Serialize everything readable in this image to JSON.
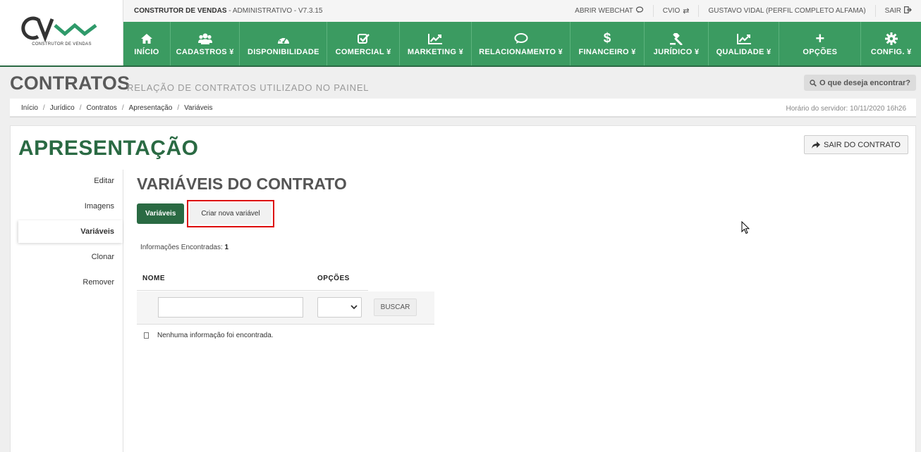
{
  "logo": {
    "subtitle": "CONSTRUTOR DE VENDAS"
  },
  "topbar": {
    "system_name": "CONSTRUTOR DE VENDAS",
    "system_suffix": "- ADMINISTRATIVO - V7.3.15",
    "links": [
      {
        "label": "ABRIR WEBCHAT",
        "icon": "chat-icon"
      },
      {
        "label": "CVIO",
        "icon": "exchange-icon"
      },
      {
        "label": "GUSTAVO VIDAL (PERFIL COMPLETO ALFAMA)",
        "icon": ""
      },
      {
        "label": "SAIR",
        "icon": "logout-icon"
      }
    ]
  },
  "navbar": {
    "items": [
      {
        "label": "INÍCIO",
        "icon": "home-icon"
      },
      {
        "label": "CADASTROS ¥",
        "icon": "users-icon"
      },
      {
        "label": "DISPONIBILIDADE",
        "icon": "dashboard-icon"
      },
      {
        "label": "COMERCIAL ¥",
        "icon": "checkbox-icon"
      },
      {
        "label": "MARKETING ¥",
        "icon": "chart-icon"
      },
      {
        "label": "RELACIONAMENTO ¥",
        "icon": "comments-icon"
      },
      {
        "label": "FINANCEIRO ¥",
        "icon": "dollar-icon"
      },
      {
        "label": "JURÍDICO ¥",
        "icon": "gavel-icon"
      },
      {
        "label": "QUALIDADE ¥",
        "icon": "chart-icon"
      },
      {
        "label": "OPÇÕES",
        "icon": "plus-icon"
      },
      {
        "label": "CONFIG. ¥",
        "icon": "gear-icon"
      }
    ]
  },
  "header": {
    "title": "CONTRATOS",
    "subtitle": "RELAÇÃO DE CONTRATOS UTILIZADO NO PAINEL",
    "search_label": "O que deseja encontrar?"
  },
  "breadcrumb": {
    "items": [
      "Início",
      "Jurídico",
      "Contratos",
      "Apresentação",
      "Variáveis"
    ],
    "server_time": "Horário do servidor: 10/11/2020 16h26"
  },
  "card": {
    "title": "APRESENTAÇÃO",
    "exit_label": "SAIR DO CONTRATO",
    "side_menu": [
      {
        "label": "Editar",
        "active": false
      },
      {
        "label": "Imagens",
        "active": false
      },
      {
        "label": "Variáveis",
        "active": true
      },
      {
        "label": "Clonar",
        "active": false
      },
      {
        "label": "Remover",
        "active": false
      }
    ],
    "section_title": "VARIÁVEIS DO CONTRATO",
    "tabs": {
      "active": "Variáveis",
      "new": "Criar nova variável"
    },
    "info_label": "Informações Encontradas:",
    "info_count": "1",
    "table": {
      "col_nome": "NOME",
      "col_opcoes": "OPÇÕES",
      "filter_value": "",
      "select_value": "",
      "search_button": "BUSCAR",
      "empty_message": "Nenhuma informação foi encontrada."
    }
  },
  "colors": {
    "nav_green": "#3b9b61",
    "dark_green": "#2a6a43",
    "highlight_red": "#dd0000"
  }
}
